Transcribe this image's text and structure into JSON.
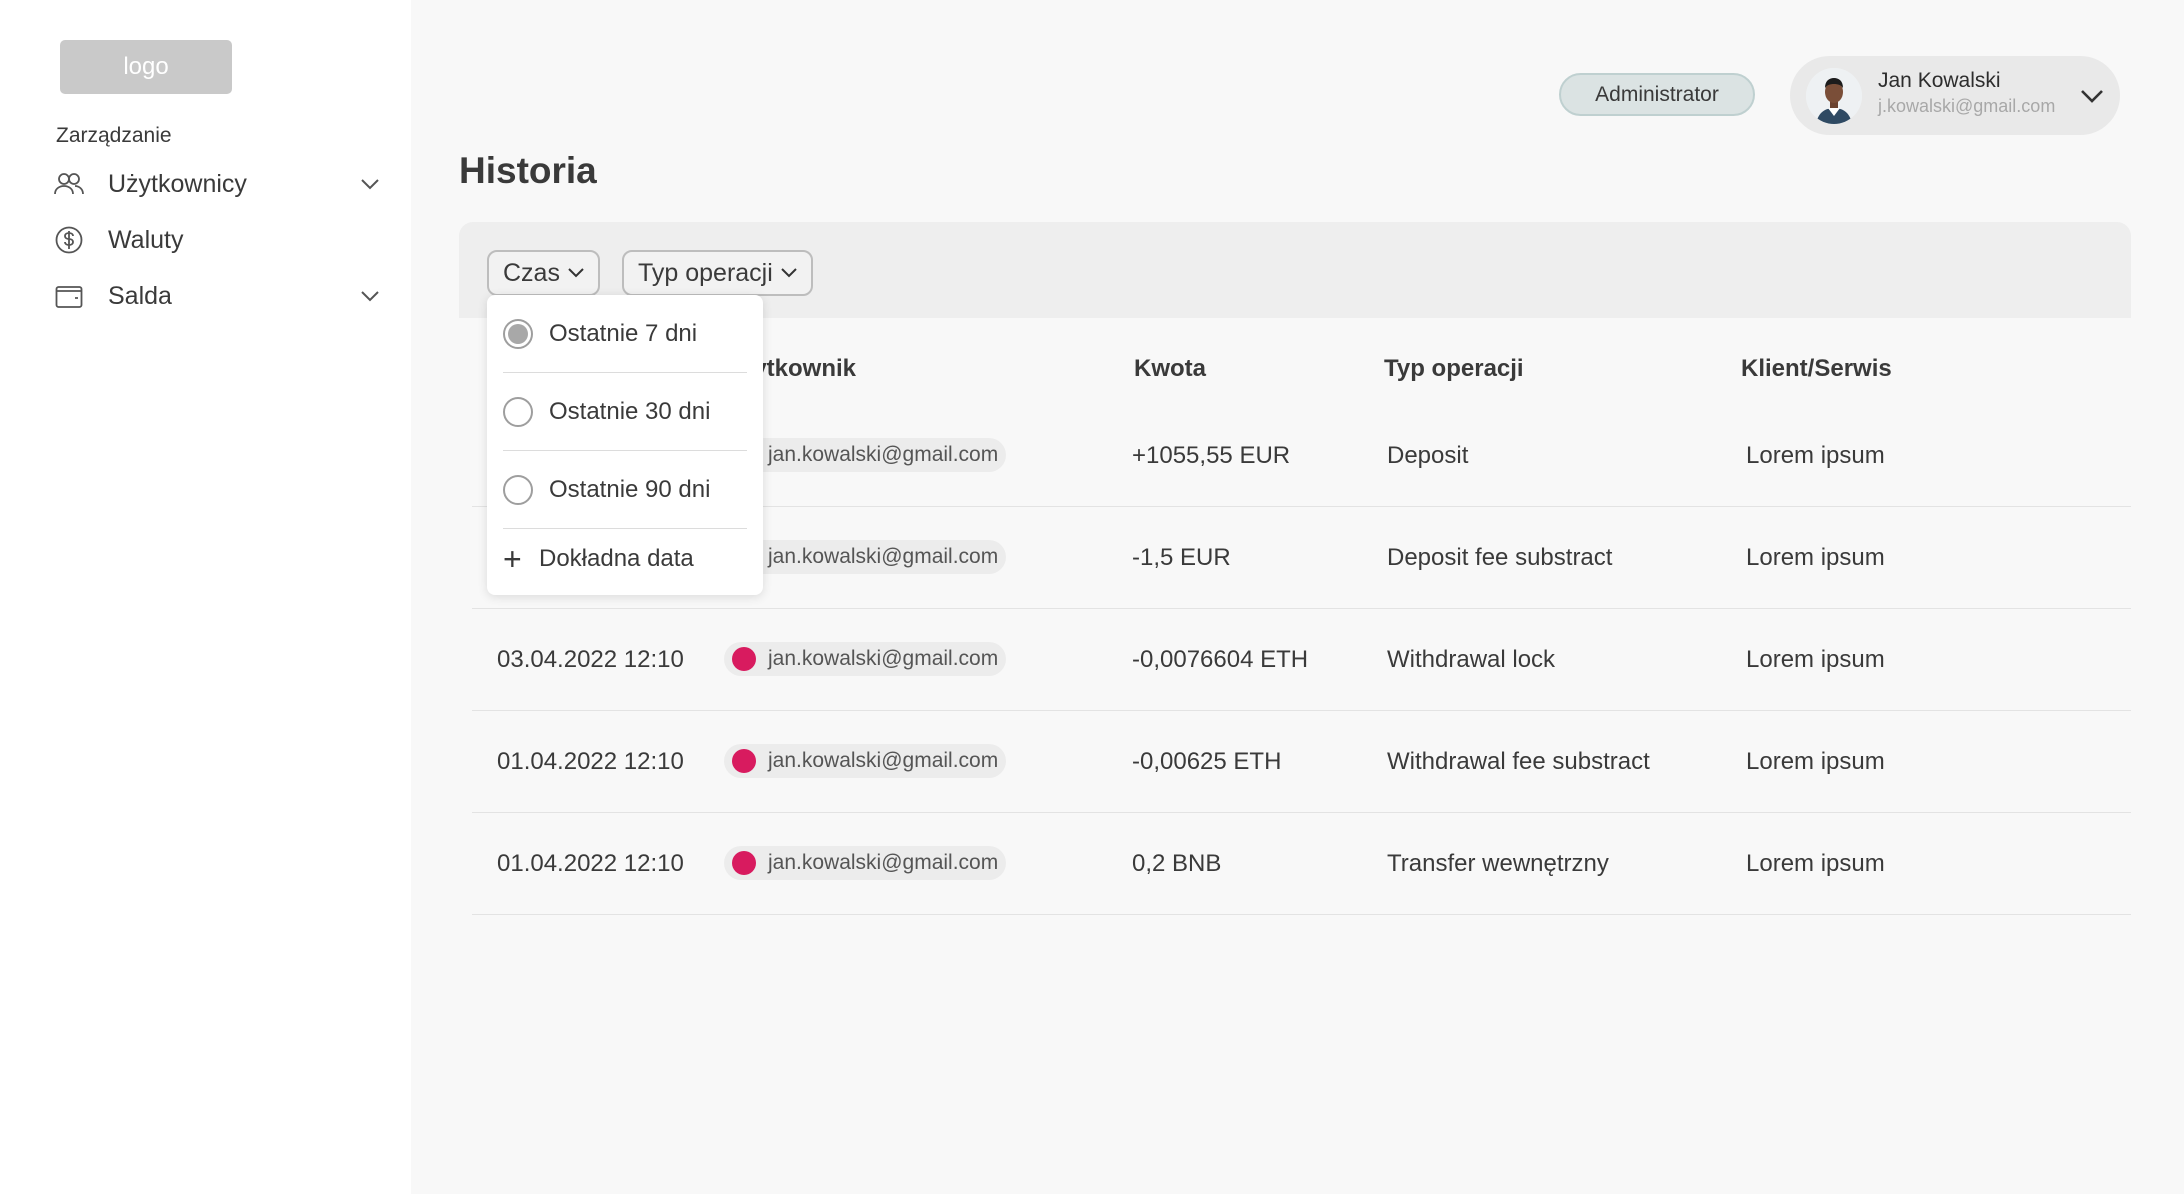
{
  "sidebar": {
    "logo": "logo",
    "section_label": "Zarządzanie",
    "items": [
      {
        "label": "Użytkownicy",
        "icon": "users-icon",
        "has_submenu": true
      },
      {
        "label": "Waluty",
        "icon": "dollar-coin-icon",
        "has_submenu": false
      },
      {
        "label": "Salda",
        "icon": "wallet-icon",
        "has_submenu": true
      }
    ]
  },
  "header": {
    "role": "Administrator",
    "user": {
      "name": "Jan Kowalski",
      "email": "j.kowalski@gmail.com"
    }
  },
  "page": {
    "title": "Historia"
  },
  "filters": {
    "time_label": "Czas",
    "type_label": "Typ operacji"
  },
  "time_dropdown": {
    "options": [
      {
        "label": "Ostatnie 7 dni",
        "selected": true
      },
      {
        "label": "Ostatnie 30 dni",
        "selected": false
      },
      {
        "label": "Ostatnie 90 dni",
        "selected": false
      }
    ],
    "exact_date": "Dokładna data"
  },
  "table": {
    "headers": {
      "user": "Użytkownik",
      "amount": "Kwota",
      "type": "Typ operacji",
      "client": "Klient/Serwis"
    },
    "rows": [
      {
        "date": "",
        "user": "jan.kowalski@gmail.com",
        "amount": "+1055,55 EUR",
        "type": "Deposit",
        "client": "Lorem ipsum"
      },
      {
        "date": "",
        "user": "jan.kowalski@gmail.com",
        "amount": "-1,5 EUR",
        "type": "Deposit fee substract",
        "client": "Lorem ipsum"
      },
      {
        "date": "03.04.2022 12:10",
        "user": "jan.kowalski@gmail.com",
        "amount": "-0,0076604 ETH",
        "type": "Withdrawal lock",
        "client": "Lorem ipsum"
      },
      {
        "date": "01.04.2022 12:10",
        "user": "jan.kowalski@gmail.com",
        "amount": "-0,00625 ETH",
        "type": "Withdrawal fee substract",
        "client": "Lorem ipsum"
      },
      {
        "date": "01.04.2022 12:10",
        "user": "jan.kowalski@gmail.com",
        "amount": "0,2 BNB",
        "type": "Transfer wewnętrzny",
        "client": "Lorem ipsum"
      }
    ]
  },
  "colors": {
    "user_dot": "#d81b5f",
    "role_badge_bg": "#dbe3e3"
  }
}
